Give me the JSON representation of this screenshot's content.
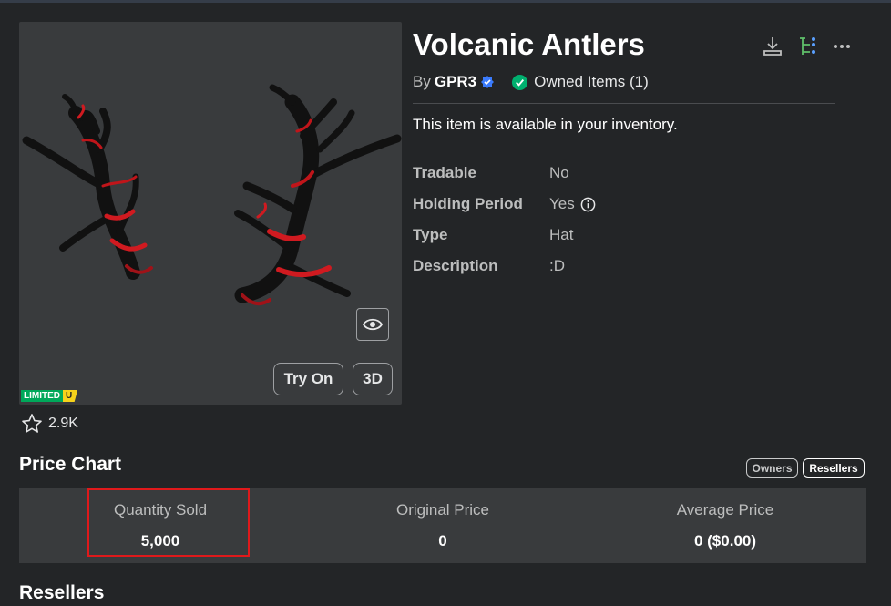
{
  "item": {
    "title": "Volcanic Antlers",
    "by_prefix": "By",
    "creator": "GPR3",
    "owned_label": "Owned Items (1)",
    "availability": "This item is available in your inventory.",
    "favorites": "2.9K",
    "badge": {
      "limited": "LIMITED",
      "unique": "U"
    }
  },
  "thumbnail_buttons": {
    "try_on": "Try On",
    "view_3d": "3D"
  },
  "details": [
    {
      "label": "Tradable",
      "value": "No"
    },
    {
      "label": "Holding Period",
      "value": "Yes"
    },
    {
      "label": "Type",
      "value": "Hat"
    },
    {
      "label": "Description",
      "value": ":D"
    }
  ],
  "price_chart": {
    "title": "Price Chart",
    "toggles": {
      "owners": "Owners",
      "resellers": "Resellers"
    },
    "stats": [
      {
        "label": "Quantity Sold",
        "value": "5,000"
      },
      {
        "label": "Original Price",
        "value": "0"
      },
      {
        "label": "Average Price",
        "value": "0 ($0.00)"
      }
    ]
  },
  "resellers_title": "Resellers",
  "colors": {
    "background": "#232527",
    "panel": "#393b3d",
    "verified": "#3a7bfd",
    "owned_check": "#00b06f",
    "highlight": "#e0191b",
    "limited_green": "#00a85a",
    "unique_yellow": "#f6d21b"
  },
  "icons": [
    "download-icon",
    "hierarchy-icon",
    "more-icon",
    "eye-icon",
    "star-icon",
    "verified-badge-icon",
    "check-circle-icon",
    "info-icon"
  ]
}
